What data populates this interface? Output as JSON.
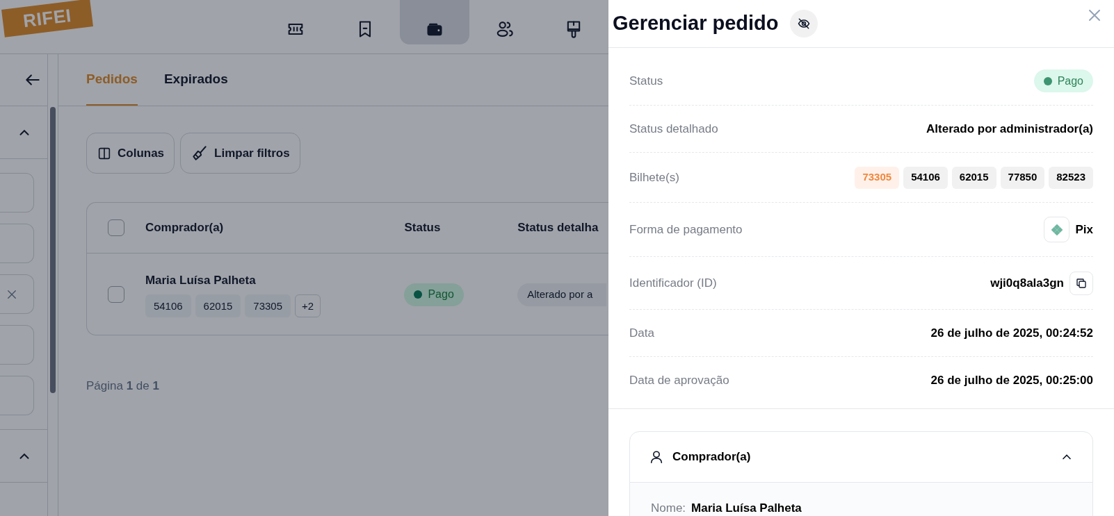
{
  "logo": {
    "text": "RIFEI"
  },
  "nav": [
    {
      "selected": false
    },
    {
      "selected": false
    },
    {
      "selected": true
    },
    {
      "selected": false
    },
    {
      "selected": false
    }
  ],
  "sidebar": {
    "sections": [
      {
        "expanded": true,
        "fields": [
          {
            "clearable": false
          },
          {
            "clearable": false
          },
          {
            "clearable": true
          },
          {
            "clearable": false
          },
          {
            "clearable": false
          }
        ]
      },
      {
        "expanded": true
      }
    ]
  },
  "tabs": [
    {
      "label": "Pedidos",
      "selected": true
    },
    {
      "label": "Expirados",
      "selected": false
    }
  ],
  "toolbar": [
    "Colunas",
    "Limpar filtros"
  ],
  "table": {
    "all_checked": false,
    "columns": [
      "Comprador(a)",
      "Status",
      "Status detalha"
    ],
    "rows": [
      {
        "checked": false,
        "buyer": "Maria Luísa Palheta",
        "tickets": [
          "54106",
          "62015",
          "73305"
        ],
        "more": "+2",
        "status": "Pago",
        "detail": "Alterado por a"
      }
    ]
  },
  "pagination": "Página **1** de **1**",
  "panel": {
    "title": "Gerenciar pedido",
    "fields": [
      {
        "kind": "badge",
        "label": "Status",
        "value": "Pago"
      },
      {
        "kind": "text",
        "label": "Status detalhado",
        "value": "Alterado por administrador(a)"
      },
      {
        "kind": "tickets",
        "label": "Bilhete(s)",
        "tickets": [
          {
            "number": "73305",
            "selected": true
          },
          {
            "number": "54106",
            "selected": false
          },
          {
            "number": "62015",
            "selected": false
          },
          {
            "number": "77850",
            "selected": false
          },
          {
            "number": "82523",
            "selected": false
          }
        ]
      },
      {
        "kind": "payment",
        "label": "Forma de pagamento",
        "value": "Pix"
      },
      {
        "kind": "id",
        "label": "Identificador (ID)",
        "value": "wji0q8ala3gn"
      },
      {
        "kind": "text",
        "label": "Data",
        "value": "26 de julho de 2025, 00:24:52"
      },
      {
        "kind": "text",
        "label": "Data de aprovação",
        "value": "26 de julho de 2025, 00:25:00"
      }
    ],
    "buyer_section": {
      "title": "Comprador(a)",
      "expanded": true,
      "fields": [
        {
          "label": "Nome:",
          "value": "Maria Luísa Palheta"
        }
      ]
    }
  }
}
